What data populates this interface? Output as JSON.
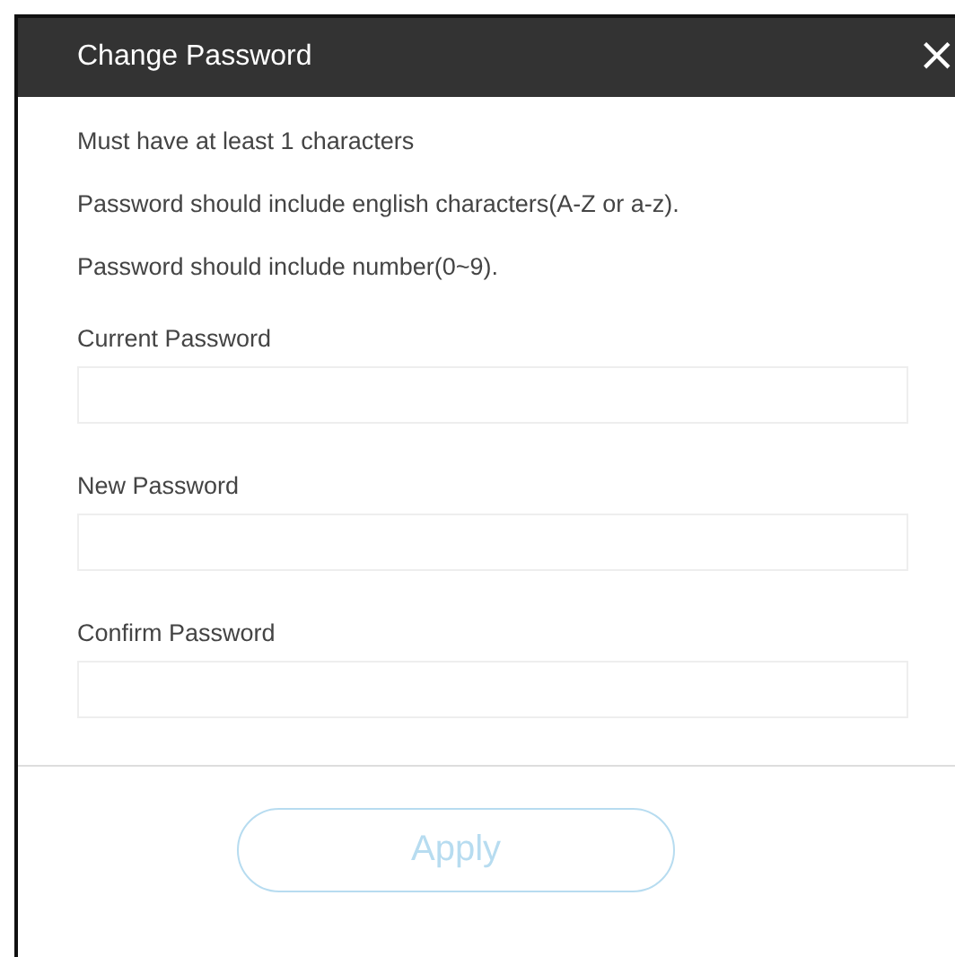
{
  "dialog": {
    "title": "Change Password",
    "close": "×"
  },
  "rules": [
    "Must have at least 1 characters",
    "Password should include english characters(A-Z or a-z).",
    "Password should include number(0~9)."
  ],
  "fields": [
    {
      "label": "Current Password"
    },
    {
      "label": "New Password"
    },
    {
      "label": "Confirm Password"
    }
  ],
  "apply_button": {
    "label": "Apply",
    "disabled": true
  }
}
